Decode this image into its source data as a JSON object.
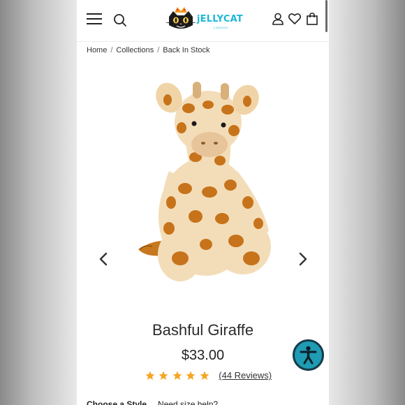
{
  "header": {
    "logo_text": "jELLYCAT",
    "logo_sub": "LONDON",
    "icons": [
      "menu-icon",
      "search-icon",
      "account-icon",
      "wishlist-heart-icon",
      "cart-bag-icon"
    ]
  },
  "breadcrumb": {
    "items": [
      "Home",
      "Collections",
      "Back In Stock"
    ],
    "separator": "/"
  },
  "product": {
    "title": "Bashful Giraffe",
    "price": "$33.00",
    "rating": 5,
    "reviews_label": "(44 Reviews)",
    "image_icon": "giraffe-plush-image"
  },
  "below_fold": {
    "label": "Choose a Style",
    "value": "Need size help?"
  },
  "colors": {
    "accent": "#1fb7d6",
    "star": "#f5a623",
    "accessibility": "#1f9bb4"
  }
}
